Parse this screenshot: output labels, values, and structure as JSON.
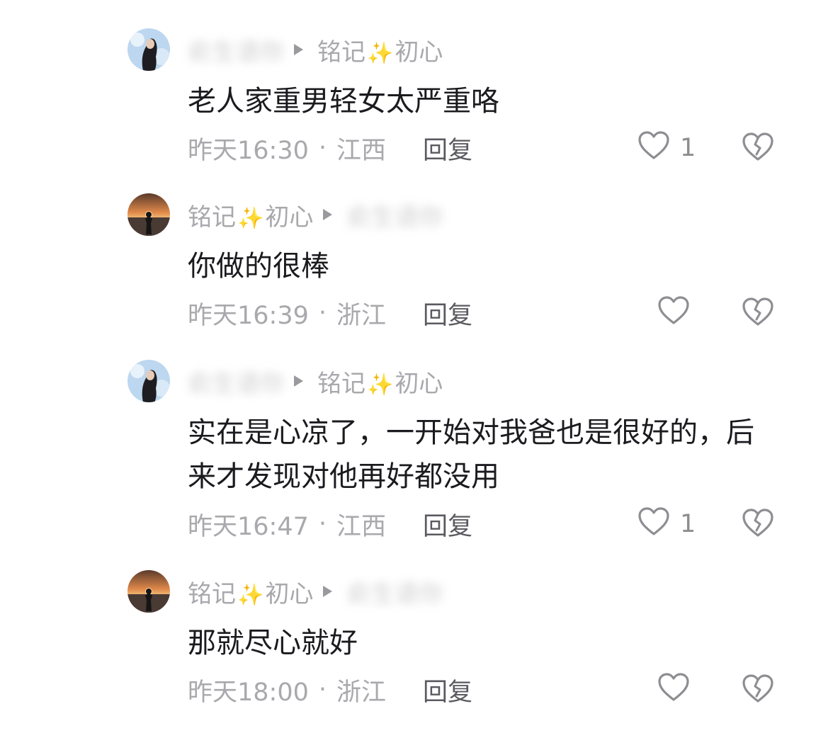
{
  "comments": [
    {
      "user": "俞生语你",
      "user_blurred": true,
      "reply_to": "铭记✨初心",
      "reply_to_blurred": false,
      "text": "老人家重男轻女太严重咯",
      "time": "昨天16:30",
      "region": "江西",
      "reply_label": "回复",
      "likes": "1",
      "avatar": "woman-dark-hair"
    },
    {
      "user": "铭记✨初心",
      "user_blurred": false,
      "reply_to": "俞生语你",
      "reply_to_blurred": true,
      "text": "你做的很棒",
      "time": "昨天16:39",
      "region": "浙江",
      "reply_label": "回复",
      "likes": "",
      "avatar": "sunset-silhouette"
    },
    {
      "user": "俞生语你",
      "user_blurred": true,
      "reply_to": "铭记✨初心",
      "reply_to_blurred": false,
      "text": "实在是心凉了，一开始对我爸也是很好的，后来才发现对他再好都没用",
      "time": "昨天16:47",
      "region": "江西",
      "reply_label": "回复",
      "likes": "1",
      "avatar": "woman-dark-hair"
    },
    {
      "user": "铭记✨初心",
      "user_blurred": false,
      "reply_to": "俞生语你",
      "reply_to_blurred": true,
      "text": "那就尽心就好",
      "time": "昨天18:00",
      "region": "浙江",
      "reply_label": "回复",
      "likes": "",
      "avatar": "sunset-silhouette"
    }
  ],
  "icons": {
    "like": "heart-outline-icon",
    "dislike": "broken-heart-icon",
    "reply_arrow": "triangle-right-icon"
  },
  "colors": {
    "name": "#a9a9ad",
    "text": "#1b1b1f",
    "reply": "#5a5a60",
    "sparkle": "#f2dfa0"
  }
}
